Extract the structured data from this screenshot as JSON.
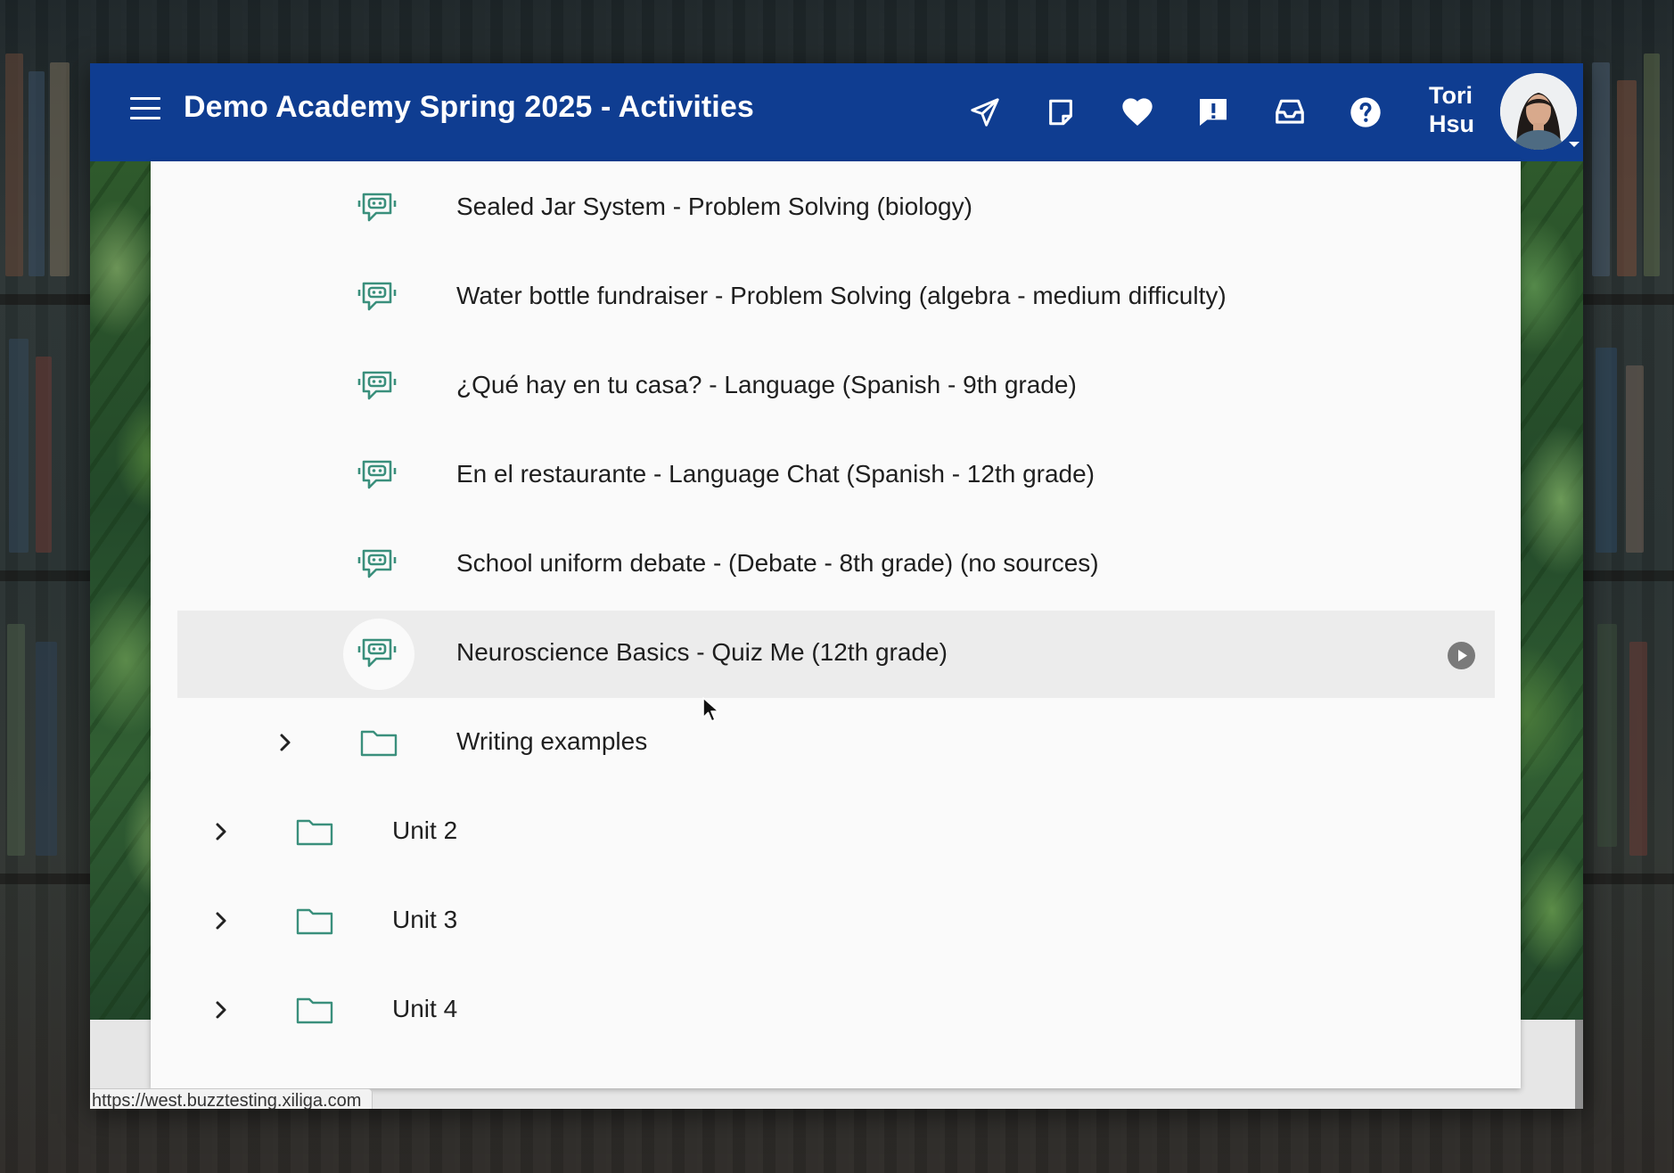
{
  "header": {
    "title": "Demo Academy Spring 2025 - Activities",
    "menu_icon": "hamburger-menu-icon",
    "icons": [
      "send-icon",
      "note-icon",
      "heart-icon",
      "alert-icon",
      "inbox-icon",
      "help-icon"
    ],
    "user": {
      "first": "Tori",
      "last": "Hsu"
    },
    "bg_color": "#0f3d91"
  },
  "activities": [
    {
      "label": "Sealed Jar System - Problem Solving (biology)",
      "icon": "chat-bot-icon"
    },
    {
      "label": "Water bottle fundraiser - Problem Solving (algebra - medium difficulty)",
      "icon": "chat-bot-icon"
    },
    {
      "label": "¿Qué hay en tu casa? - Language (Spanish - 9th grade)",
      "icon": "chat-bot-icon"
    },
    {
      "label": "En el restaurante - Language Chat (Spanish - 12th grade)",
      "icon": "chat-bot-icon"
    },
    {
      "label": "School uniform debate - (Debate - 8th grade) (no sources)",
      "icon": "chat-bot-icon"
    },
    {
      "label": "Neuroscience Basics - Quiz Me (12th grade)",
      "icon": "chat-bot-icon",
      "hovered": true
    }
  ],
  "folders": [
    {
      "label": "Writing examples",
      "icon": "folder-icon"
    },
    {
      "label": "Unit 2",
      "icon": "folder-icon"
    },
    {
      "label": "Unit 3",
      "icon": "folder-icon"
    },
    {
      "label": "Unit 4",
      "icon": "folder-icon"
    }
  ],
  "status_url": "https://west.buzztesting.xiliga.com",
  "colors": {
    "icon_teal": "#3a8f7c",
    "hover_row": "#ececec"
  }
}
